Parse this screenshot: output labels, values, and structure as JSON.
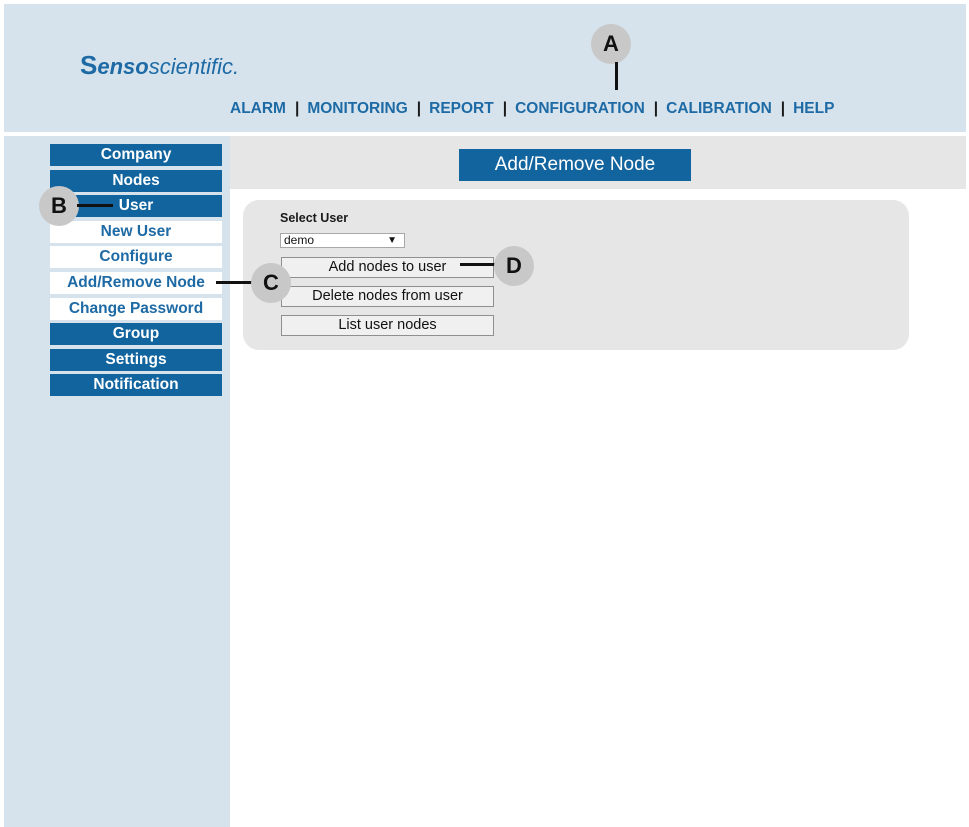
{
  "brand": {
    "mark": "S",
    "bold": "enso",
    "rest": "scientific.",
    "color": "#1d6aa5"
  },
  "nav": {
    "items": [
      "ALARM",
      "MONITORING",
      "REPORT",
      "CONFIGURATION",
      "CALIBRATION",
      "HELP"
    ],
    "separator": "|"
  },
  "sidebar": {
    "items": [
      {
        "label": "Company",
        "style": "primary"
      },
      {
        "label": "Nodes",
        "style": "primary"
      },
      {
        "label": "User",
        "style": "primary"
      },
      {
        "label": "New User",
        "style": "sub"
      },
      {
        "label": "Configure",
        "style": "sub"
      },
      {
        "label": "Add/Remove Node",
        "style": "sub"
      },
      {
        "label": "Change Password",
        "style": "sub"
      },
      {
        "label": "Group",
        "style": "primary"
      },
      {
        "label": "Settings",
        "style": "primary"
      },
      {
        "label": "Notification",
        "style": "primary"
      }
    ]
  },
  "page": {
    "title": "Add/Remove Node"
  },
  "form": {
    "select_label": "Select User",
    "selected_user": "demo",
    "dropdown_arrow": "▼",
    "buttons": {
      "add": "Add nodes to user",
      "delete": "Delete nodes from user",
      "list": "List user nodes"
    }
  },
  "callouts": {
    "a": "A",
    "b": "B",
    "c": "C",
    "d": "D"
  },
  "colors": {
    "background": "#d6e3ed",
    "accent": "#12649f",
    "link": "#1d6aa5",
    "panel": "#e6e6e6",
    "callout": "#c8c8c8"
  }
}
